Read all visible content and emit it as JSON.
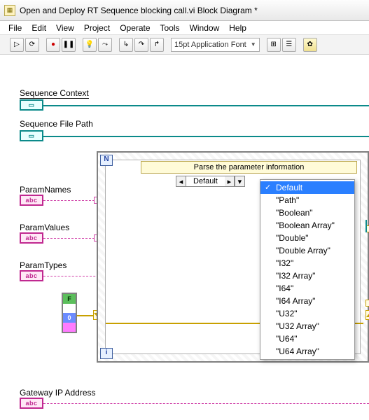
{
  "window": {
    "title": "Open and Deploy RT Sequence blocking call.vi Block Diagram *"
  },
  "menubar": {
    "file": "File",
    "edit": "Edit",
    "view": "View",
    "project": "Project",
    "operate": "Operate",
    "tools": "Tools",
    "window": "Window",
    "help": "Help"
  },
  "toolbar": {
    "font": "15pt Application Font"
  },
  "labels": {
    "sequence_context": "Sequence Context",
    "sequence_file_path": "Sequence File Path",
    "param_names": "ParamNames",
    "param_values": "ParamValues",
    "param_types": "ParamTypes",
    "gateway_ip": "Gateway IP Address"
  },
  "terminal_text": {
    "path": "▭",
    "abc": "abc"
  },
  "forloop": {
    "N": "N",
    "i": "i",
    "header": "Parse the parameter information",
    "case_value": "Default",
    "left_arrow": "◂",
    "right_arrow": "▸",
    "dv": "▾"
  },
  "dropdown": {
    "items": [
      "Default",
      "\"Path\"",
      "\"Boolean\"",
      "\"Boolean Array\"",
      "\"Double\"",
      "\"Double Array\"",
      "\"I32\"",
      "\"I32 Array\"",
      "\"I64\"",
      "\"I64 Array\"",
      "\"U32\"",
      "\"U32 Array\"",
      "\"U64\"",
      "\"U64 Array\""
    ],
    "selected_index": 0,
    "checkmark": "✓"
  },
  "consts": {
    "F": "F",
    "zero": "0"
  },
  "qmark": "?"
}
